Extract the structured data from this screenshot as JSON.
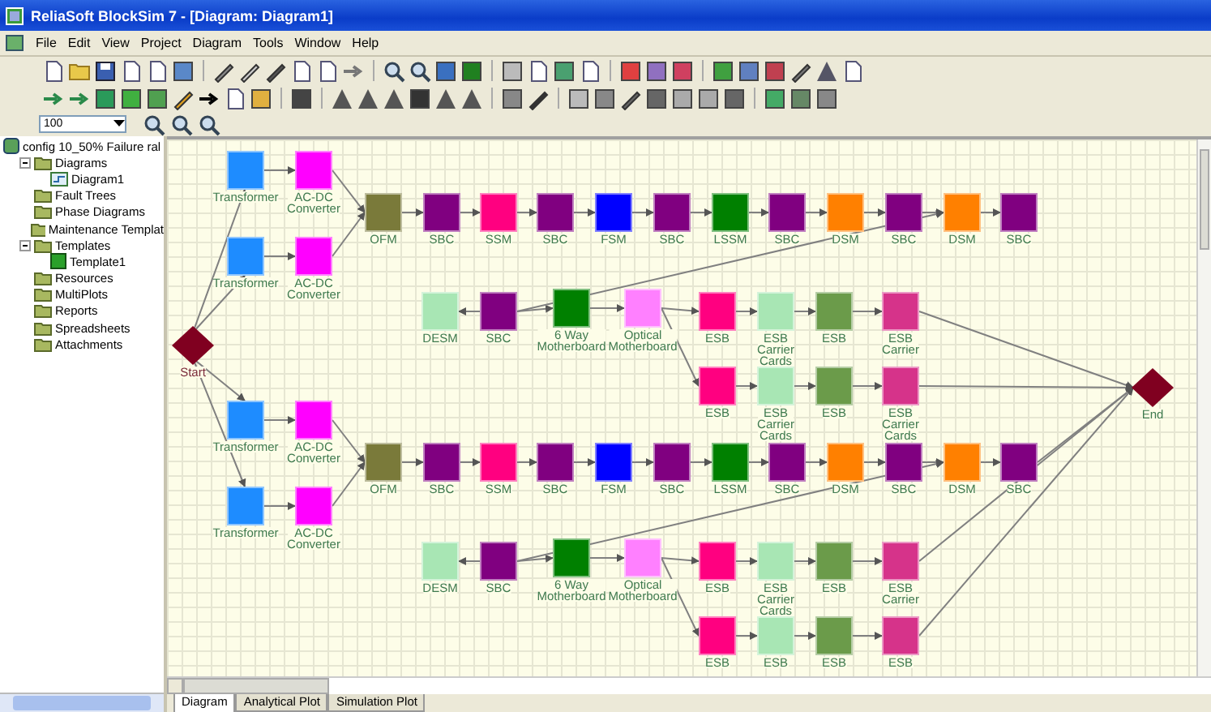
{
  "window": {
    "title": "ReliaSoft BlockSim 7 - [Diagram: Diagram1]"
  },
  "menu": [
    "File",
    "Edit",
    "View",
    "Project",
    "Diagram",
    "Tools",
    "Window",
    "Help"
  ],
  "zoom": {
    "value": "100"
  },
  "project_tree": {
    "label": "config 10_50% Failure ral",
    "children": [
      {
        "label": "Diagrams",
        "kind": "folder",
        "expanded": true,
        "children": [
          {
            "label": "Diagram1",
            "kind": "diagram"
          }
        ]
      },
      {
        "label": "Fault Trees",
        "kind": "folder"
      },
      {
        "label": "Phase Diagrams",
        "kind": "folder"
      },
      {
        "label": "Maintenance Templat",
        "kind": "folder"
      },
      {
        "label": "Templates",
        "kind": "folder",
        "expanded": true,
        "children": [
          {
            "label": "Template1",
            "kind": "template"
          }
        ]
      },
      {
        "label": "Resources",
        "kind": "folder"
      },
      {
        "label": "MultiPlots",
        "kind": "folder"
      },
      {
        "label": "Reports",
        "kind": "folder"
      },
      {
        "label": "Spreadsheets",
        "kind": "folder"
      },
      {
        "label": "Attachments",
        "kind": "folder"
      }
    ]
  },
  "diagram": {
    "nodes": [
      {
        "kind": "block",
        "label": "Transformer",
        "color": "#1e8cff"
      },
      {
        "kind": "block",
        "label": "AC-DC\nConverter",
        "color": "#ff00ff"
      },
      {
        "kind": "block",
        "label": "Transformer",
        "color": "#1e8cff"
      },
      {
        "kind": "block",
        "label": "AC-DC\nConverter",
        "color": "#ff00ff"
      },
      {
        "kind": "block",
        "label": "OFM",
        "color": "#7a7a3a"
      },
      {
        "kind": "block",
        "label": "SBC",
        "color": "#800080"
      },
      {
        "kind": "block",
        "label": "SSM",
        "color": "#ff0080"
      },
      {
        "kind": "block",
        "label": "SBC",
        "color": "#800080"
      },
      {
        "kind": "block",
        "label": "FSM",
        "color": "#0000ff"
      },
      {
        "kind": "block",
        "label": "SBC",
        "color": "#800080"
      },
      {
        "kind": "block",
        "label": "LSSM",
        "color": "#008000"
      },
      {
        "kind": "block",
        "label": "SBC",
        "color": "#800080"
      },
      {
        "kind": "block",
        "label": "DSM",
        "color": "#ff8000"
      },
      {
        "kind": "block",
        "label": "SBC",
        "color": "#800080"
      },
      {
        "kind": "block",
        "label": "DSM",
        "color": "#ff8000"
      },
      {
        "kind": "block",
        "label": "SBC",
        "color": "#800080"
      },
      {
        "kind": "block",
        "label": "DESM",
        "color": "#a8e6b4"
      },
      {
        "kind": "block",
        "label": "SBC",
        "color": "#800080"
      },
      {
        "kind": "block",
        "label": "6 Way\nMotherboard",
        "color": "#008000"
      },
      {
        "kind": "block",
        "label": "Optical\nMotherboard",
        "color": "#ff80ff"
      },
      {
        "kind": "block",
        "label": "ESB",
        "color": "#ff0080"
      },
      {
        "kind": "block",
        "label": "ESB\nCarrier\nCards",
        "color": "#a8e6b4"
      },
      {
        "kind": "block",
        "label": "ESB",
        "color": "#6b9b4a"
      },
      {
        "kind": "block",
        "label": "ESB\nCarrier",
        "color": "#d6338a"
      },
      {
        "kind": "block",
        "label": "ESB",
        "color": "#ff0080"
      },
      {
        "kind": "block",
        "label": "ESB\nCarrier\nCards",
        "color": "#a8e6b4"
      },
      {
        "kind": "block",
        "label": "ESB",
        "color": "#6b9b4a"
      },
      {
        "kind": "block",
        "label": "ESB\nCarrier\nCards",
        "color": "#d6338a"
      },
      {
        "kind": "start",
        "label": "Start"
      },
      {
        "kind": "end",
        "label": "End"
      },
      {
        "kind": "block",
        "label": "Transformer",
        "color": "#1e8cff"
      },
      {
        "kind": "block",
        "label": "AC-DC\nConverter",
        "color": "#ff00ff"
      },
      {
        "kind": "block",
        "label": "Transformer",
        "color": "#1e8cff"
      },
      {
        "kind": "block",
        "label": "AC-DC\nConverter",
        "color": "#ff00ff"
      },
      {
        "kind": "block",
        "label": "OFM",
        "color": "#7a7a3a"
      },
      {
        "kind": "block",
        "label": "SBC",
        "color": "#800080"
      },
      {
        "kind": "block",
        "label": "SSM",
        "color": "#ff0080"
      },
      {
        "kind": "block",
        "label": "SBC",
        "color": "#800080"
      },
      {
        "kind": "block",
        "label": "FSM",
        "color": "#0000ff"
      },
      {
        "kind": "block",
        "label": "SBC",
        "color": "#800080"
      },
      {
        "kind": "block",
        "label": "LSSM",
        "color": "#008000"
      },
      {
        "kind": "block",
        "label": "SBC",
        "color": "#800080"
      },
      {
        "kind": "block",
        "label": "DSM",
        "color": "#ff8000"
      },
      {
        "kind": "block",
        "label": "SBC",
        "color": "#800080"
      },
      {
        "kind": "block",
        "label": "DSM",
        "color": "#ff8000"
      },
      {
        "kind": "block",
        "label": "SBC",
        "color": "#800080"
      },
      {
        "kind": "block",
        "label": "DESM",
        "color": "#a8e6b4"
      },
      {
        "kind": "block",
        "label": "SBC",
        "color": "#800080"
      },
      {
        "kind": "block",
        "label": "6 Way\nMotherboard",
        "color": "#008000"
      },
      {
        "kind": "block",
        "label": "Optical\nMotherboard",
        "color": "#ff80ff"
      },
      {
        "kind": "block",
        "label": "ESB",
        "color": "#ff0080"
      },
      {
        "kind": "block",
        "label": "ESB\nCarrier\nCards",
        "color": "#a8e6b4"
      },
      {
        "kind": "block",
        "label": "ESB",
        "color": "#6b9b4a"
      },
      {
        "kind": "block",
        "label": "ESB\nCarrier",
        "color": "#d6338a"
      },
      {
        "kind": "block",
        "label": "ESB",
        "color": "#ff0080"
      },
      {
        "kind": "block",
        "label": "ESB",
        "color": "#a8e6b4"
      },
      {
        "kind": "block",
        "label": "ESB",
        "color": "#6b9b4a"
      },
      {
        "kind": "block",
        "label": "ESB",
        "color": "#d6338a"
      }
    ]
  },
  "tabs": [
    {
      "label": "Diagram",
      "selected": true
    },
    {
      "label": "Analytical Plot",
      "selected": false
    },
    {
      "label": "Simulation Plot",
      "selected": false
    }
  ]
}
